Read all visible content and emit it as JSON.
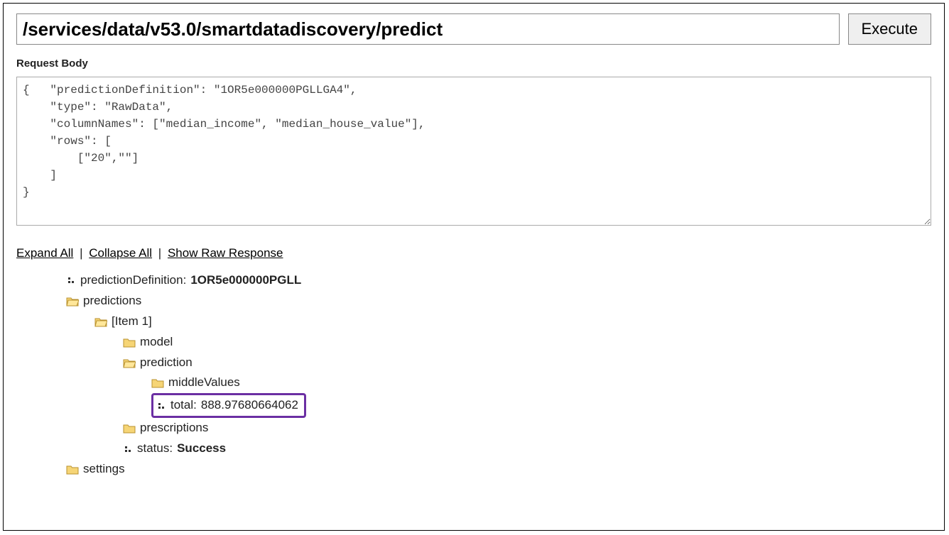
{
  "url_value": "/services/data/v53.0/smartdatadiscovery/predict",
  "execute_label": "Execute",
  "request_body_label": "Request Body",
  "request_body_value": "{   \"predictionDefinition\": \"1OR5e000000PGLLGA4\",\n    \"type\": \"RawData\",\n    \"columnNames\": [\"median_income\", \"median_house_value\"],\n    \"rows\": [\n        [\"20\",\"\"]\n    ]\n}",
  "links": {
    "expand_all": "Expand All",
    "collapse_all": "Collapse All",
    "show_raw": "Show Raw Response"
  },
  "tree": {
    "predictionDefinition_key": "predictionDefinition: ",
    "predictionDefinition_val": "1OR5e000000PGLL",
    "predictions_label": "predictions",
    "item1_label": "[Item 1]",
    "model_label": "model",
    "prediction_label": "prediction",
    "middleValues_label": "middleValues",
    "total_key": "total: ",
    "total_val": "888.97680664062",
    "prescriptions_label": "prescriptions",
    "status_key": "status: ",
    "status_val": "Success",
    "settings_label": "settings"
  }
}
